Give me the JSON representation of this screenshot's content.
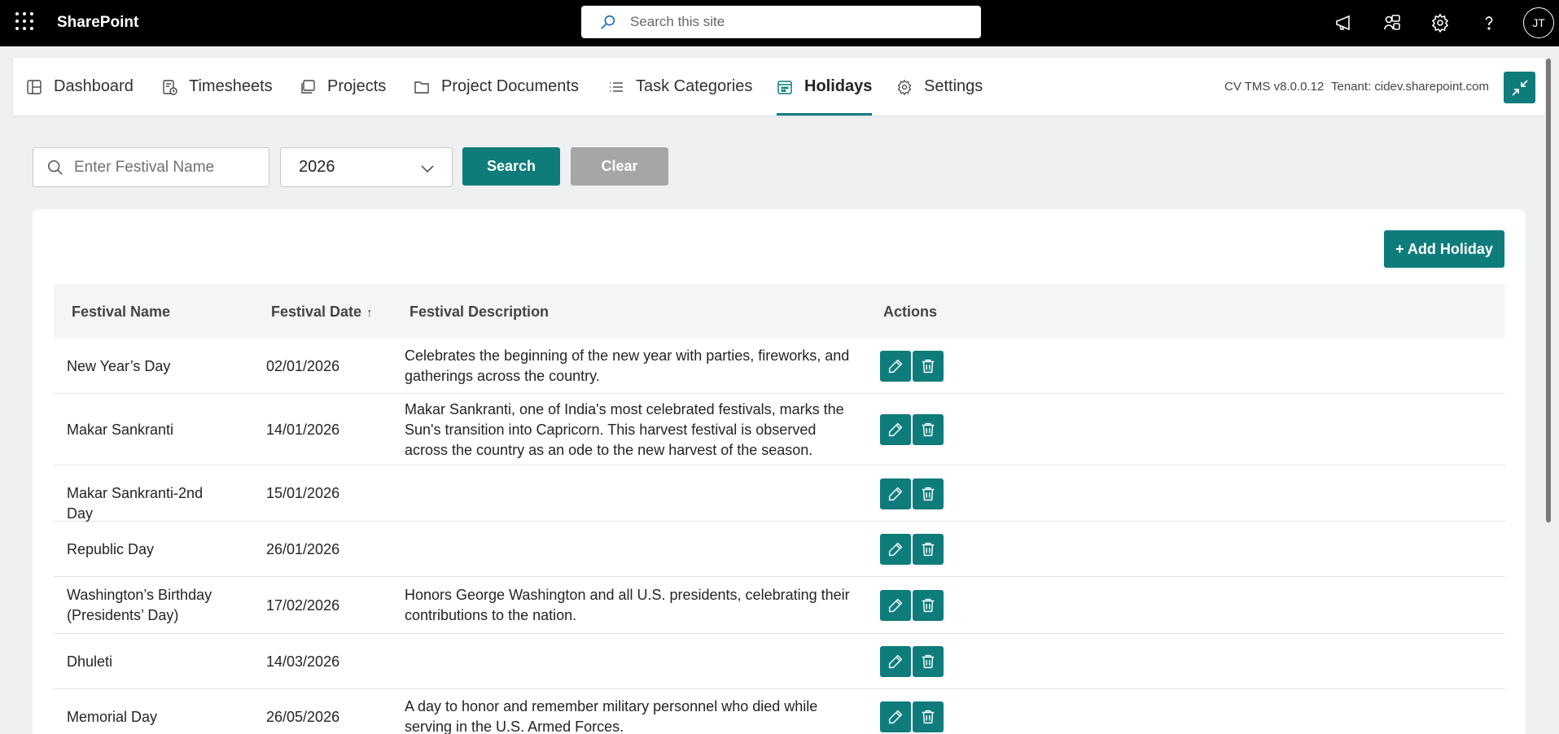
{
  "suite": {
    "brand": "SharePoint",
    "search_placeholder": "Search this site",
    "avatar_initials": "JT"
  },
  "nav": {
    "tabs": [
      {
        "label": "Dashboard",
        "icon": "dashboard-icon"
      },
      {
        "label": "Timesheets",
        "icon": "timesheet-icon"
      },
      {
        "label": "Projects",
        "icon": "projects-icon"
      },
      {
        "label": "Project Documents",
        "icon": "folder-icon"
      },
      {
        "label": "Task Categories",
        "icon": "list-icon"
      },
      {
        "label": "Holidays",
        "icon": "calendar-icon",
        "active": true
      },
      {
        "label": "Settings",
        "icon": "gear-icon"
      }
    ],
    "version": "CV TMS v8.0.0.12",
    "tenant": "Tenant: cidev.sharepoint.com"
  },
  "filters": {
    "festival_placeholder": "Enter Festival Name",
    "year": "2026",
    "search_label": "Search",
    "clear_label": "Clear"
  },
  "add_label": "+ Add Holiday",
  "table": {
    "headers": {
      "name": "Festival Name",
      "date": "Festival Date",
      "sort_indicator": "↑",
      "description": "Festival Description",
      "actions": "Actions"
    },
    "rows": [
      {
        "name": "New Year’s Day",
        "date": "02/01/2026",
        "description": "Celebrates the beginning of the new year with parties, fireworks, and gatherings across the country."
      },
      {
        "name": "Makar Sankranti",
        "date": "14/01/2026",
        "description": "Makar Sankranti, one of India's most celebrated festivals, marks the Sun's transition into Capricorn. This harvest festival is observed across the country as an ode to the new harvest of the season."
      },
      {
        "name": "Makar Sankranti-2nd Day",
        "date": "15/01/2026",
        "description": ""
      },
      {
        "name": "Republic Day",
        "date": "26/01/2026",
        "description": ""
      },
      {
        "name": "Washington’s Birthday (Presidents’ Day)",
        "date": "17/02/2026",
        "description": "Honors George Washington and all U.S. presidents, celebrating their contributions to the nation."
      },
      {
        "name": "Dhuleti",
        "date": "14/03/2026",
        "description": ""
      },
      {
        "name": "Memorial Day",
        "date": "26/05/2026",
        "description": "A day to honor and remember military personnel who died while serving in the U.S. Armed Forces."
      }
    ]
  },
  "colors": {
    "accent": "#0e7c7b",
    "suite_bar": "#000000",
    "clear_button": "#a6a6a6"
  }
}
